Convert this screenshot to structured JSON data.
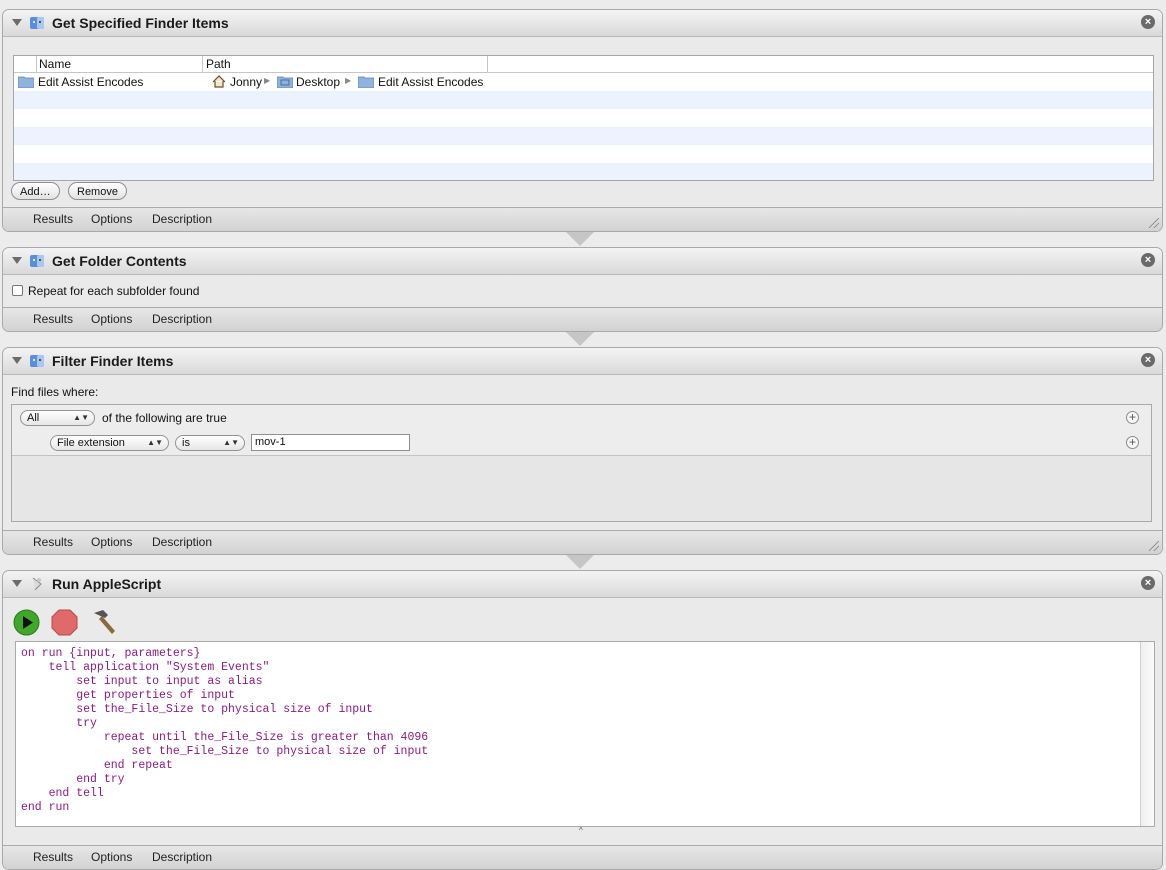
{
  "actions": {
    "get_finder_items": {
      "title": "Get Specified Finder Items",
      "columns": {
        "name": "Name",
        "path": "Path"
      },
      "row": {
        "name": "Edit Assist Encodes",
        "path": [
          "Jonny",
          "Desktop",
          "Edit Assist Encodes"
        ]
      },
      "add_label": "Add…",
      "remove_label": "Remove"
    },
    "get_folder_contents": {
      "title": "Get Folder Contents",
      "checkbox_label": "Repeat for each subfolder found"
    },
    "filter_finder_items": {
      "title": "Filter Finder Items",
      "find_label": "Find files where:",
      "match_value": "All",
      "match_suffix": "of the following are true",
      "criterion": {
        "field": "File extension",
        "operator": "is",
        "value": "mov-1"
      }
    },
    "run_applescript": {
      "title": "Run AppleScript",
      "code": [
        "on run {input, parameters}",
        "    tell application \"System Events\"",
        "        set input to input as alias",
        "        get properties of input",
        "        set the_File_Size to physical size of input",
        "        try",
        "            repeat until the_File_Size is greater than 4096",
        "                set the_File_Size to physical size of input",
        "            end repeat",
        "        end try",
        "    end tell",
        "end run"
      ]
    }
  },
  "footer_tabs": {
    "results": "Results",
    "options": "Options",
    "description": "Description"
  },
  "colors": {
    "code_text": "#8b1c7f",
    "row_alt": "#edf3fe",
    "run_green": "#3fa82a",
    "stop_red": "#e05a5a"
  }
}
